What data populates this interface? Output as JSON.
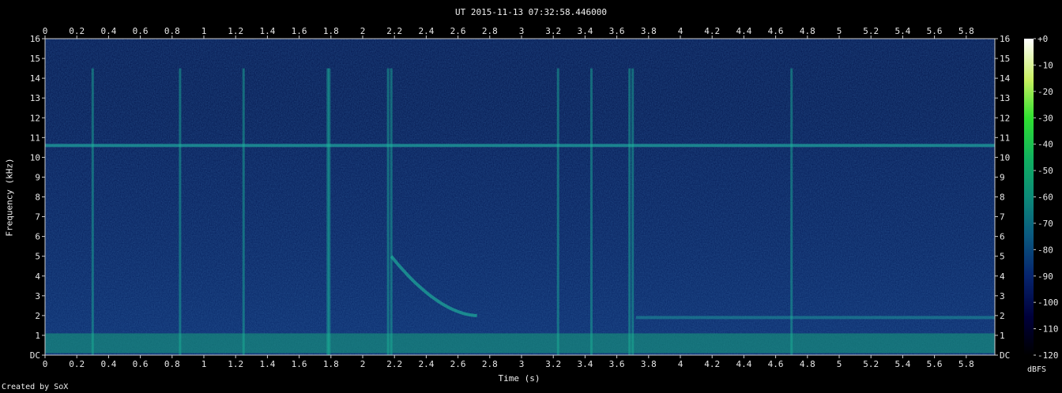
{
  "chart_data": {
    "type": "heatmap",
    "title": "UT 2015-11-13 07:32:58.446000",
    "xlabel": "Time (s)",
    "ylabel": "Frequency (kHz)",
    "xlim": [
      0,
      5.98
    ],
    "ylim": [
      0,
      16
    ],
    "x_ticks": [
      "0",
      "0.2",
      "0.4",
      "0.6",
      "0.8",
      "1",
      "1.2",
      "1.4",
      "1.6",
      "1.8",
      "2",
      "2.2",
      "2.4",
      "2.6",
      "2.8",
      "3",
      "3.2",
      "3.4",
      "3.6",
      "3.8",
      "4",
      "4.2",
      "4.4",
      "4.6",
      "4.8",
      "5",
      "5.2",
      "5.4",
      "5.6",
      "5.8"
    ],
    "y_ticks": [
      "DC",
      "1",
      "2",
      "3",
      "4",
      "5",
      "6",
      "7",
      "8",
      "9",
      "10",
      "11",
      "12",
      "13",
      "14",
      "15",
      "16"
    ],
    "colorbar": {
      "label": "dBFS",
      "ticks": [
        "+0",
        "-10",
        "-20",
        "-30",
        "-40",
        "-50",
        "-60",
        "-70",
        "-80",
        "-90",
        "-100",
        "-110",
        "-120"
      ],
      "range": [
        -120,
        0
      ]
    },
    "background_level_dbfs": -100,
    "features": [
      {
        "kind": "tone",
        "freq_khz": 10.6,
        "level_dbfs": -85
      },
      {
        "kind": "low_band",
        "freq_range_khz": [
          0.1,
          1.1
        ],
        "level_dbfs": -80
      },
      {
        "kind": "whistler",
        "t_start_s": 2.18,
        "t_end_s": 2.72,
        "f_start_khz": 5.0,
        "f_end_khz": 2.0
      },
      {
        "kind": "tone",
        "freq_khz": 1.9,
        "t_range_s": [
          3.72,
          5.98
        ],
        "level_dbfs": -88
      },
      {
        "kind": "impulses",
        "times_s": [
          0.3,
          0.85,
          1.25,
          1.78,
          1.79,
          2.16,
          2.18,
          3.23,
          3.44,
          3.68,
          3.7,
          4.7
        ]
      }
    ]
  },
  "footer": {
    "credit": "Created by SoX"
  }
}
